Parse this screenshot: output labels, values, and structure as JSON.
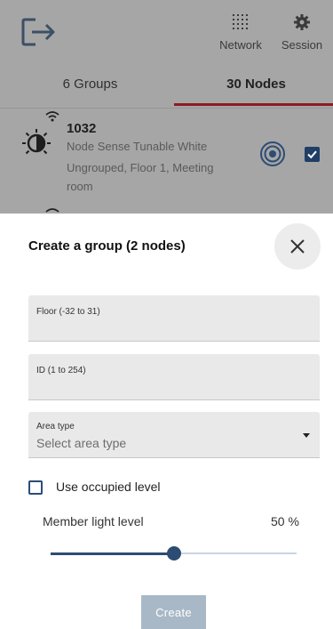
{
  "header": {
    "network_label": "Network",
    "session_label": "Session"
  },
  "tabs": [
    {
      "label": "6 Groups",
      "active": false
    },
    {
      "label": "30 Nodes",
      "active": true
    }
  ],
  "node": {
    "id": "1032",
    "type": "Node Sense Tunable White",
    "location": "Ungrouped, Floor 1, Meeting room",
    "selected": true
  },
  "dialog": {
    "title": "Create a group (2 nodes)",
    "floor": {
      "label": "Floor (-32 to 31)",
      "value": ""
    },
    "id_field": {
      "label": "ID (1 to 254)",
      "value": ""
    },
    "area_type": {
      "label": "Area type",
      "placeholder": "Select area type"
    },
    "use_occupied": {
      "label": "Use occupied level",
      "checked": false
    },
    "member_level": {
      "label": "Member light level",
      "value_text": "50 %",
      "value": 50
    },
    "create_label": "Create"
  },
  "colors": {
    "accent": "#2d4c73",
    "tab_underline": "#8c1c22",
    "overlay": "#a6a6a6",
    "button_disabled": "#a9b8c7"
  },
  "icons": [
    "logout-icon",
    "grid-icon",
    "gear-icon",
    "wifi-icon",
    "light-sensor-icon",
    "identify-icon",
    "close-icon",
    "chevron-down-icon"
  ]
}
